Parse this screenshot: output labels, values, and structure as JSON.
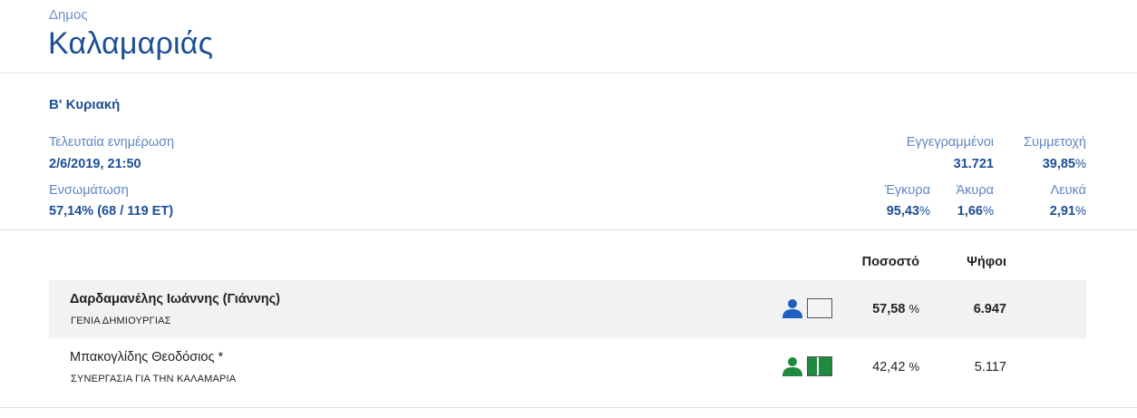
{
  "header": {
    "type_label": "Δημος",
    "name": "Καλαμαριάς"
  },
  "stats": {
    "round": "Β' Κυριακή",
    "last_update": {
      "label": "Τελευταία ενημέρωση",
      "value": "2/6/2019, 21:50"
    },
    "incorporation": {
      "label": "Ενσωμάτωση",
      "value": "57,14% (68 / 119 ΕΤ)"
    },
    "registered": {
      "label": "Εγγεγραμμένοι",
      "value": "31.721"
    },
    "turnout": {
      "label": "Συμμετοχή",
      "value": "39,85",
      "unit": "%"
    },
    "valid": {
      "label": "Έγκυρα",
      "value": "95,43",
      "unit": "%"
    },
    "invalid": {
      "label": "Άκυρα",
      "value": "1,66",
      "unit": "%"
    },
    "blank": {
      "label": "Λευκά",
      "value": "2,91",
      "unit": "%"
    }
  },
  "results": {
    "headers": {
      "percent": "Ποσοστό",
      "votes": "Ψήφοι"
    },
    "candidates": [
      {
        "name": "Δαρδαμανέλης Ιωάννης (Γιάννης)",
        "party": "ΓΕΝΙΑ ΔΗΜΙΟΥΡΓΙΑΣ",
        "percent": "57,58",
        "percent_unit": "%",
        "votes": "6.947",
        "person_icon": "person-icon",
        "person_color": "#1f5fbf",
        "flag_icon": "party-flag-icon",
        "flag_colors": [
          "#f4f4f4"
        ]
      },
      {
        "name": "Μπακογλίδης Θεοδόσιος *",
        "party": "ΣΥΝΕΡΓΑΣΙΑ ΓΙΑ ΤΗΝ ΚΑΛΑΜΑΡΙΑ",
        "percent": "42,42",
        "percent_unit": "%",
        "votes": "5.117",
        "person_icon": "person-icon",
        "person_color": "#1f8a3d",
        "flag_icon": "party-flag-icon",
        "flag_colors": [
          "#1f8a3d",
          "#ffffff",
          "#1f8a3d"
        ]
      }
    ]
  }
}
